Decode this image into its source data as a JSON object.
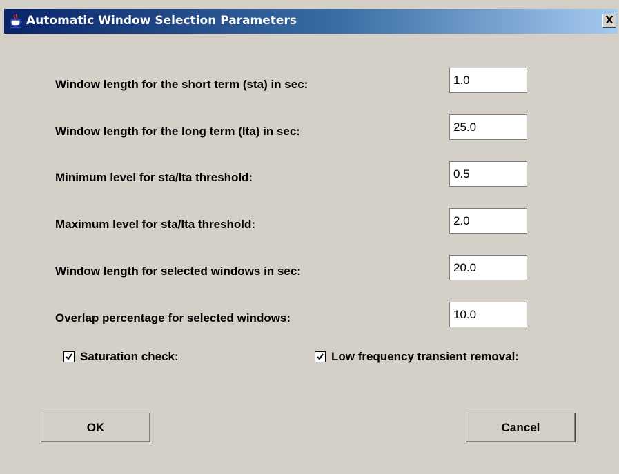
{
  "window": {
    "title": "Automatic Window Selection Parameters",
    "close_glyph": "X",
    "app_icon": "java-cup-icon"
  },
  "fields": [
    {
      "label": "Window length for the short term (sta) in sec:",
      "value": "1.0"
    },
    {
      "label": "Window length for the long term (lta) in sec:",
      "value": "25.0"
    },
    {
      "label": "Minimum level for sta/lta threshold:",
      "value": "0.5"
    },
    {
      "label": "Maximum level for sta/lta threshold:",
      "value": "2.0"
    },
    {
      "label": "Window length for selected windows in sec:",
      "value": "20.0"
    },
    {
      "label": "Overlap percentage for selected windows:",
      "value": "10.0"
    }
  ],
  "checks": {
    "saturation": {
      "label": "Saturation check:",
      "checked": true
    },
    "low_freq": {
      "label": "Low frequency transient removal:",
      "checked": true
    }
  },
  "buttons": {
    "ok": "OK",
    "cancel": "Cancel"
  },
  "colors": {
    "title_start": "#0a246a",
    "title_end": "#a6caf0",
    "dialog_bg": "#d4d0c8"
  }
}
